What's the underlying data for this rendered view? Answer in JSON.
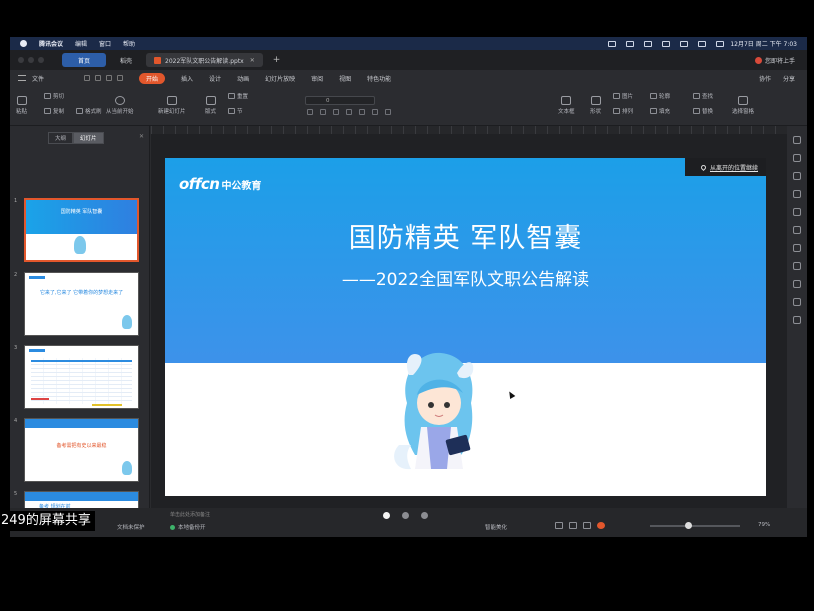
{
  "mac_menubar": {
    "app_name": "腾讯会议",
    "menus": [
      "编辑",
      "窗口",
      "帮助"
    ],
    "clock": "12月7日 周二 下午 7:03"
  },
  "tabs": {
    "home": "首页",
    "docs": "稻壳",
    "file": "2022军队文职公告解读.pptx",
    "login": "您即将上手"
  },
  "ribbon_menu": {
    "file": "文件",
    "items": [
      "开始",
      "插入",
      "设计",
      "动画",
      "幻灯片放映",
      "审阅",
      "视图",
      "特色功能"
    ],
    "active": "开始",
    "collab": "协作",
    "share": "分享"
  },
  "toolbar": {
    "paste": "粘贴",
    "cut": "剪切",
    "copy": "复制",
    "format_painter": "格式刷",
    "from_current": "从当前开始",
    "new_slide": "新建幻灯片",
    "layout": "版式",
    "reset": "重置",
    "section": "节",
    "font_size": "0",
    "textbox": "文本框",
    "shape": "形状",
    "image": "图片",
    "arrange": "排列",
    "outline": "轮廓",
    "fill": "填充",
    "find": "查找",
    "replace": "替换",
    "select_pane": "选择窗格"
  },
  "left_panel": {
    "tab_outline": "大纲",
    "tab_slides": "幻灯片",
    "slides": [
      {
        "num": "1",
        "text": "国防精英 军队智囊"
      },
      {
        "num": "2",
        "text": "它来了,它来了 它带着你的梦想走来了"
      },
      {
        "num": "3",
        "text": ""
      },
      {
        "num": "4",
        "text": "备考需把有史以来最稳"
      },
      {
        "num": "5",
        "text": "备考 规划在前"
      }
    ]
  },
  "slide": {
    "brand_en": "offcn",
    "brand_cn": "中公教育",
    "title": "国防精英 军队智囊",
    "subtitle": "——2022全国军队文职公告解读",
    "resume_label": "从离开的位置继续"
  },
  "statusbar": {
    "notes_placeholder": "单击此处添加备注",
    "protect": "文档未保护",
    "local": "本地备份开",
    "beautify": "智能美化",
    "zoom": "79%"
  },
  "share_label": "249的屏幕共享",
  "colors": {
    "accent": "#e2572c",
    "slide_blue": "#1c9fe8",
    "tab_home": "#2d5ea8"
  }
}
